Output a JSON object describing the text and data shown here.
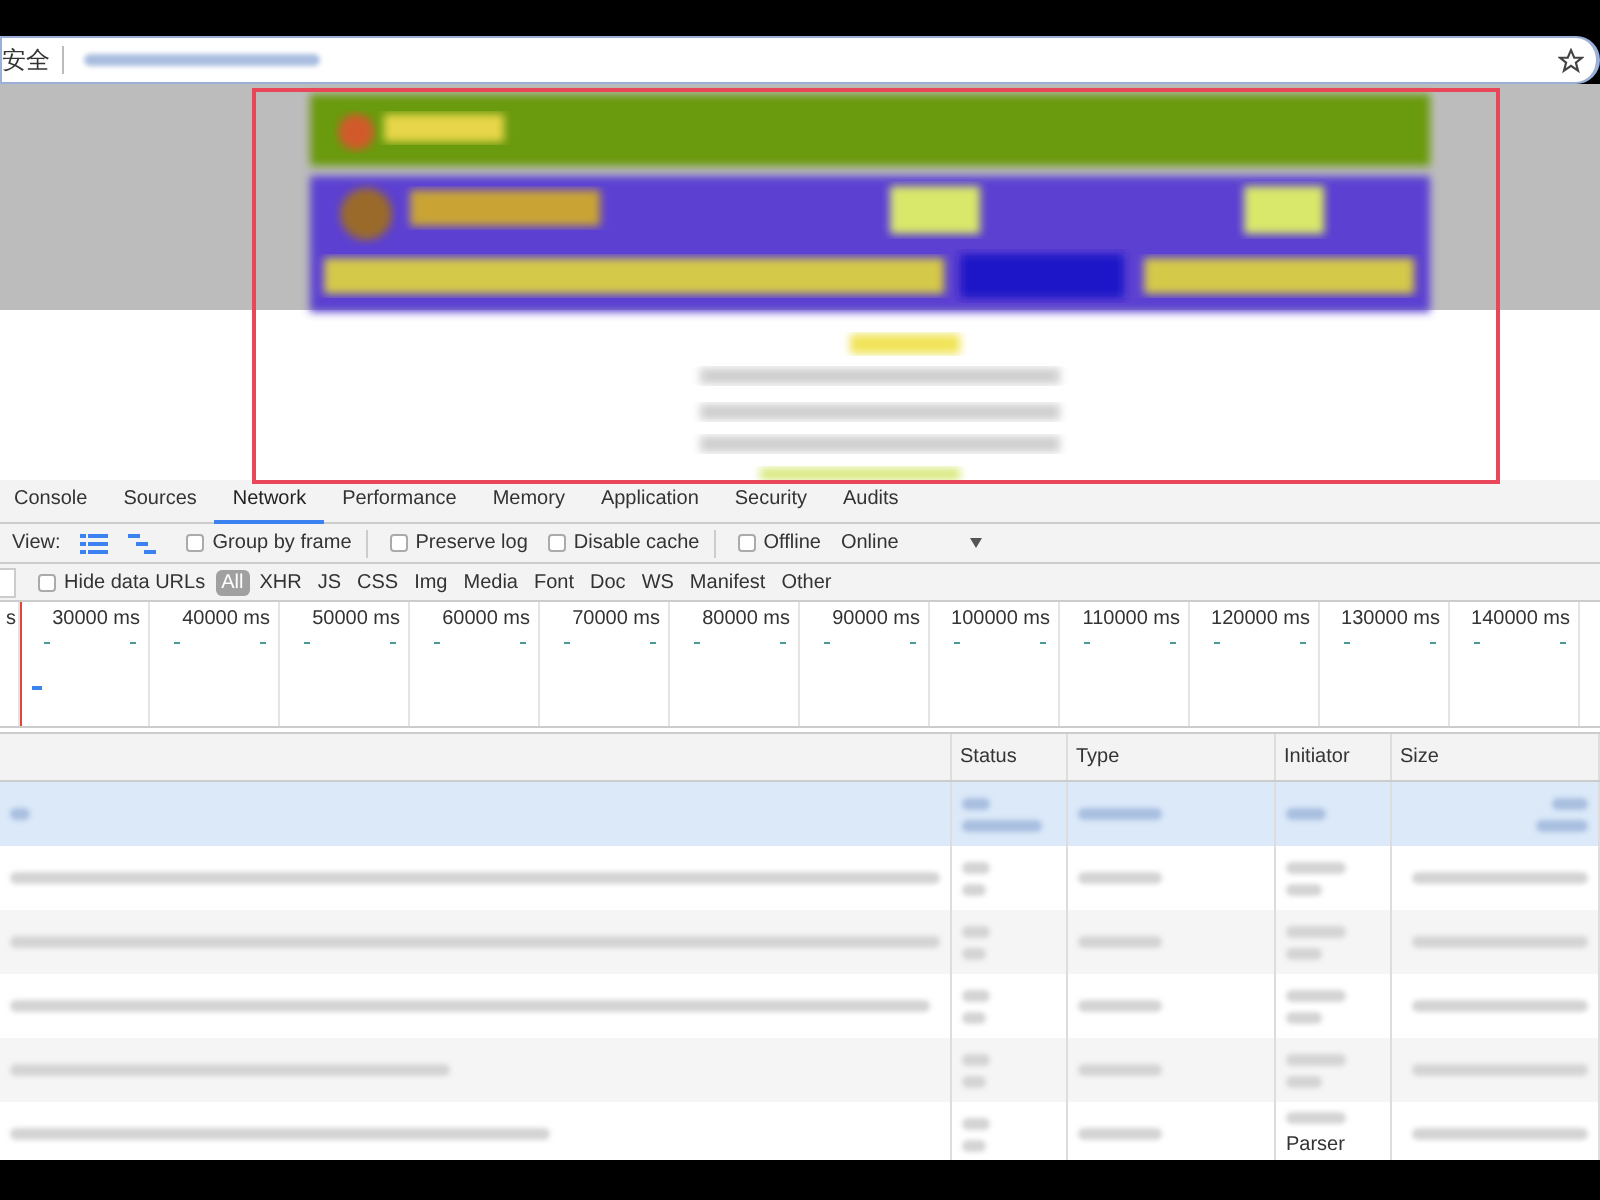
{
  "address_bar": {
    "security_label": "安全"
  },
  "devtools": {
    "tabs": [
      {
        "label": "Console",
        "selected": false
      },
      {
        "label": "Sources",
        "selected": false
      },
      {
        "label": "Network",
        "selected": true
      },
      {
        "label": "Performance",
        "selected": false
      },
      {
        "label": "Memory",
        "selected": false
      },
      {
        "label": "Application",
        "selected": false
      },
      {
        "label": "Security",
        "selected": false
      },
      {
        "label": "Audits",
        "selected": false
      }
    ],
    "toolbar": {
      "view_label": "View:",
      "view_modes": [
        {
          "kind": "list",
          "selected": true
        },
        {
          "kind": "waterfall",
          "selected": true
        }
      ],
      "options": [
        {
          "label": "Group by frame",
          "checked": false,
          "separator_after": true
        },
        {
          "label": "Preserve log",
          "checked": false,
          "separator_after": false
        },
        {
          "label": "Disable cache",
          "checked": false,
          "separator_after": true
        },
        {
          "label": "Offline",
          "checked": false,
          "separator_after": false
        }
      ],
      "throttling": "Online"
    },
    "filter_bar": {
      "hide_data_urls": {
        "label": "Hide data URLs",
        "checked": false
      },
      "types": [
        {
          "label": "All",
          "selected": true
        },
        {
          "label": "XHR",
          "selected": false
        },
        {
          "label": "JS",
          "selected": false
        },
        {
          "label": "CSS",
          "selected": false
        },
        {
          "label": "Img",
          "selected": false
        },
        {
          "label": "Media",
          "selected": false
        },
        {
          "label": "Font",
          "selected": false
        },
        {
          "label": "Doc",
          "selected": false
        },
        {
          "label": "WS",
          "selected": false
        },
        {
          "label": "Manifest",
          "selected": false
        },
        {
          "label": "Other",
          "selected": false
        }
      ]
    },
    "timeline_ticks": [
      "s",
      "30000 ms",
      "40000 ms",
      "50000 ms",
      "60000 ms",
      "70000 ms",
      "80000 ms",
      "90000 ms",
      "100000 ms",
      "110000 ms",
      "120000 ms",
      "130000 ms",
      "140000 ms"
    ],
    "table": {
      "columns": [
        "Status",
        "Type",
        "Initiator",
        "Size"
      ],
      "rows": [
        {
          "selected": true
        },
        {
          "selected": false
        },
        {
          "selected": false
        },
        {
          "selected": false
        },
        {
          "selected": false
        },
        {
          "selected": false,
          "initiator": "Parser"
        }
      ]
    }
  }
}
